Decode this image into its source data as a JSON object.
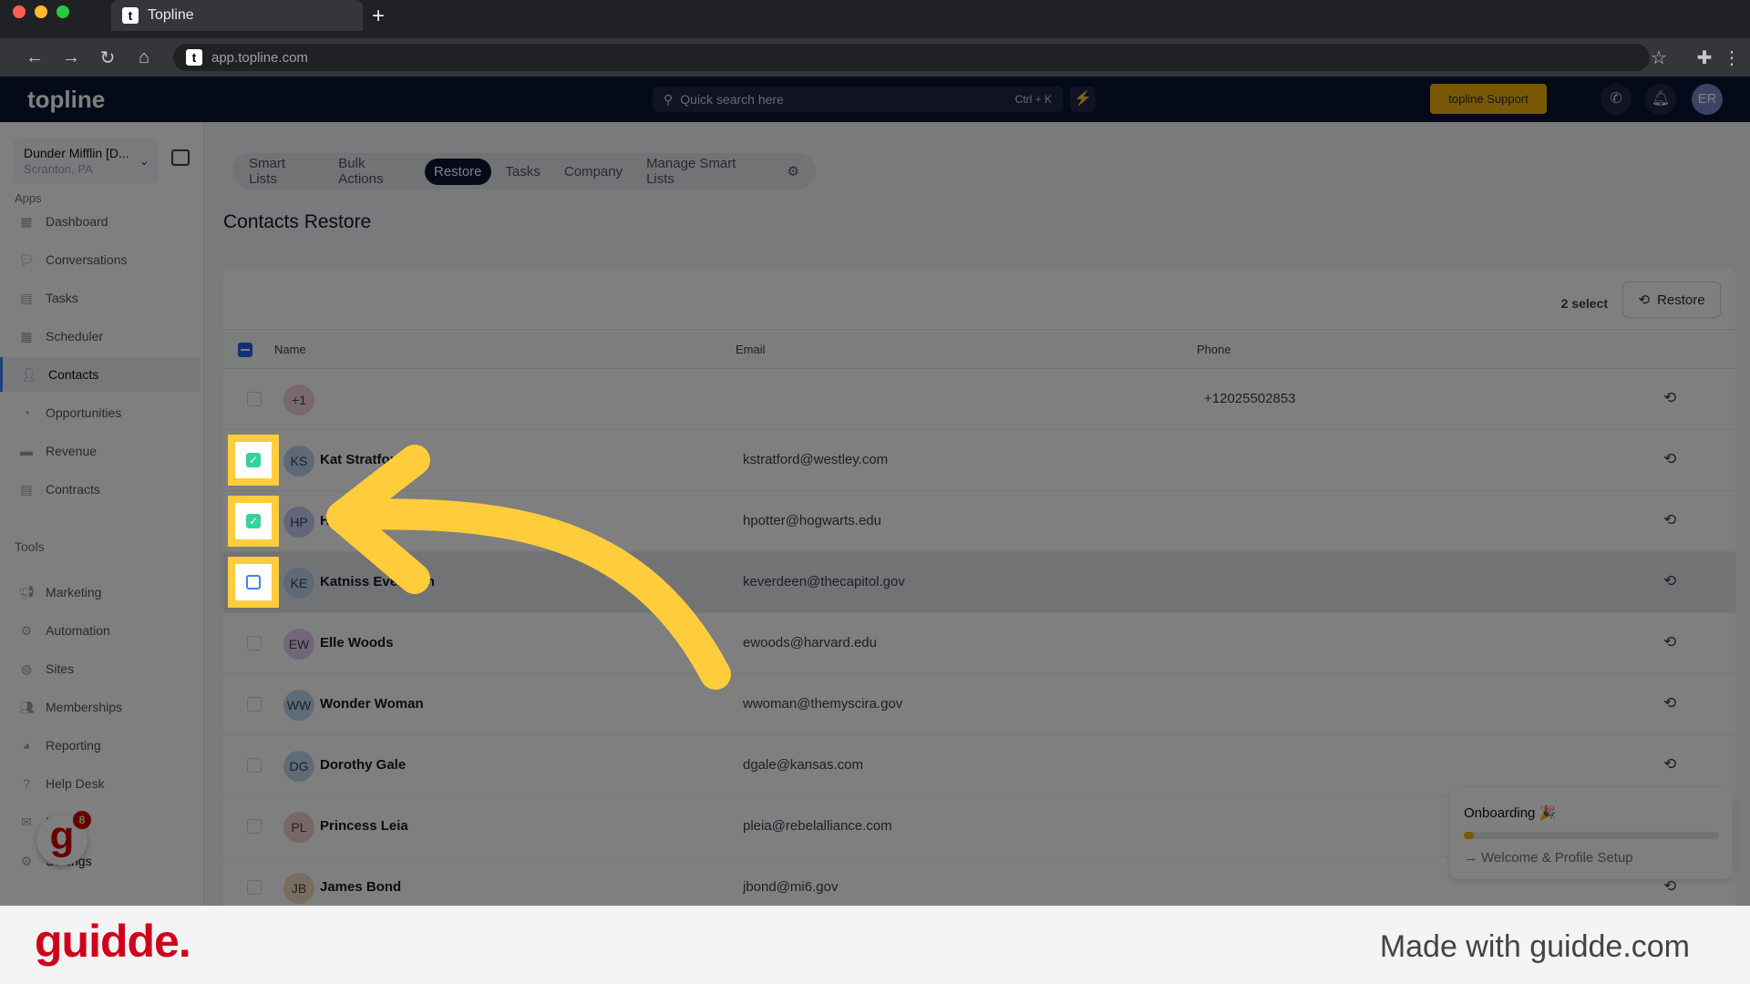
{
  "browser": {
    "tab_title": "Topline",
    "url": "app.topline.com"
  },
  "header": {
    "logo": "topline",
    "search_placeholder": "Quick search here",
    "search_shortcut": "Ctrl + K",
    "support_label": "topline Support",
    "avatar": "ER"
  },
  "sidebar": {
    "location_name": "Dunder Mifflin [D...",
    "location_sub": "Scranton, PA",
    "apps_label": "Apps",
    "tools_label": "Tools",
    "apps": [
      {
        "label": "Dashboard",
        "icon": "dashboard-icon"
      },
      {
        "label": "Conversations",
        "icon": "chat-icon"
      },
      {
        "label": "Tasks",
        "icon": "tasks-icon"
      },
      {
        "label": "Scheduler",
        "icon": "calendar-icon"
      },
      {
        "label": "Contacts",
        "icon": "user-icon",
        "active": true
      },
      {
        "label": "Opportunities",
        "icon": "opportunities-icon"
      },
      {
        "label": "Revenue",
        "icon": "revenue-icon"
      },
      {
        "label": "Contracts",
        "icon": "contract-icon"
      }
    ],
    "tools": [
      {
        "label": "Marketing",
        "icon": "megaphone-icon"
      },
      {
        "label": "Automation",
        "icon": "gears-icon"
      },
      {
        "label": "Sites",
        "icon": "globe-icon"
      },
      {
        "label": "Memberships",
        "icon": "members-icon"
      },
      {
        "label": "Reporting",
        "icon": "pie-icon"
      },
      {
        "label": "Help Desk",
        "icon": "help-icon"
      },
      {
        "label": "Mailfold",
        "icon": "mail-icon"
      }
    ],
    "settings": "Settings",
    "guidde_badge_count": "8"
  },
  "tabs": [
    {
      "label": "Smart Lists"
    },
    {
      "label": "Bulk Actions"
    },
    {
      "label": "Restore",
      "active": true
    },
    {
      "label": "Tasks"
    },
    {
      "label": "Company"
    },
    {
      "label": "Manage Smart Lists"
    }
  ],
  "page_title": "Contacts Restore",
  "toolbar": {
    "selected": "2 select",
    "restore_label": "Restore"
  },
  "table": {
    "columns": [
      "Name",
      "Email",
      "Phone"
    ],
    "rows": [
      {
        "initials": "+1",
        "name": "",
        "email": "",
        "phone": "+12025502853",
        "checked": false,
        "color": "#f3d1dc"
      },
      {
        "initials": "KS",
        "name": "Kat Stratford",
        "email": "kstratford@westley.com",
        "phone": "",
        "checked": true,
        "color": "#bcd3f0"
      },
      {
        "initials": "HP",
        "name": "Harry Potter",
        "email": "hpotter@hogwarts.edu",
        "phone": "",
        "checked": true,
        "color": "#c7cdf0"
      },
      {
        "initials": "KE",
        "name": "Katniss Everdeen",
        "email": "keverdeen@thecapitol.gov",
        "phone": "",
        "checked": false,
        "hover": true,
        "color": "#bcd3f0"
      },
      {
        "initials": "EW",
        "name": "Elle Woods",
        "email": "ewoods@harvard.edu",
        "phone": "",
        "checked": false,
        "color": "#e6cdf0"
      },
      {
        "initials": "WW",
        "name": "Wonder Woman",
        "email": "wwoman@themyscira.gov",
        "phone": "",
        "checked": false,
        "color": "#bcd8f0"
      },
      {
        "initials": "DG",
        "name": "Dorothy Gale",
        "email": "dgale@kansas.com",
        "phone": "",
        "checked": false,
        "color": "#bcd8f0"
      },
      {
        "initials": "PL",
        "name": "Princess Leia",
        "email": "pleia@rebelalliance.com",
        "phone": "",
        "checked": false,
        "color": "#f3cfcf"
      },
      {
        "initials": "JB",
        "name": "James Bond",
        "email": "jbond@mi6.gov",
        "phone": "",
        "checked": false,
        "color": "#f0dcc0"
      }
    ]
  },
  "onboarding": {
    "title": "Onboarding 🎉",
    "progress_percent": 4,
    "link": "Welcome & Profile Setup"
  },
  "footer": {
    "logo": "guidde.",
    "made_with": "Made with guidde.com"
  },
  "colors": {
    "accent": "#f3b10a",
    "header_bg": "#0b1437",
    "highlight": "#ffcd3c",
    "check": "#34d399"
  }
}
